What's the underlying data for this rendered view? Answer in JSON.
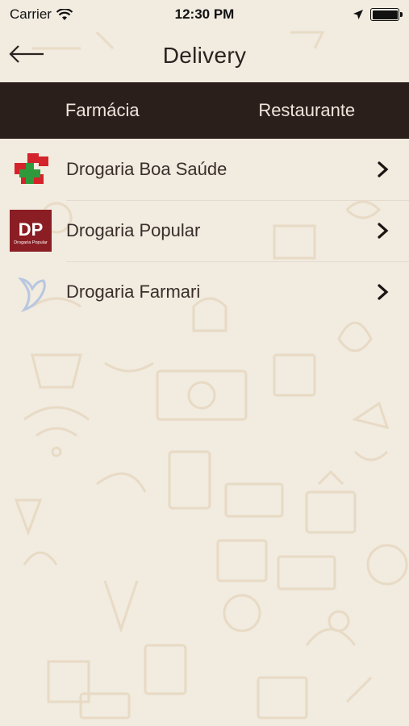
{
  "status_bar": {
    "carrier": "Carrier",
    "time": "12:30 PM"
  },
  "nav": {
    "title": "Delivery",
    "back_icon": "back-arrow-icon"
  },
  "tabs": [
    {
      "label": "Farmácia"
    },
    {
      "label": "Restaurante"
    }
  ],
  "stores": [
    {
      "name": "Drogaria Boa Saúde",
      "logo": "cross-logo"
    },
    {
      "name": "Drogaria Popular",
      "logo": "dp-logo",
      "logo_text": "DP",
      "logo_subtext": "Drogaria Popular"
    },
    {
      "name": "Drogaria Farmari",
      "logo": "heart-logo"
    }
  ],
  "colors": {
    "background": "#f1ebe0",
    "tab_bar": "#2b1f1c",
    "tab_text": "#efe6dc",
    "dp_logo_bg": "#8b1e24",
    "cross_red": "#d4232a",
    "cross_green": "#2e9a3c"
  }
}
